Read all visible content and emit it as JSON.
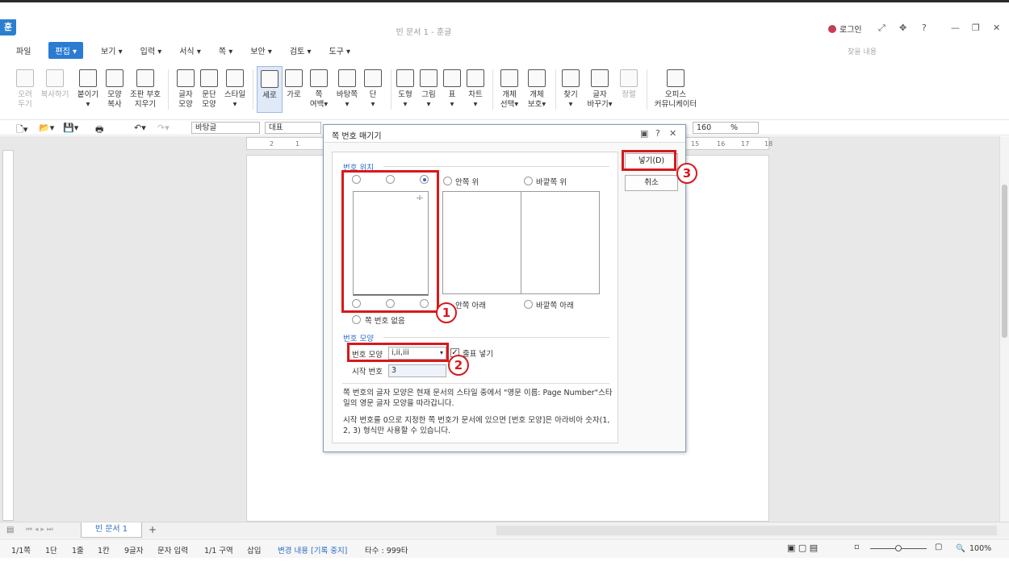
{
  "app": {
    "logo": "훈",
    "title": "빈 문서 1 - 훈글",
    "login": "로그인",
    "search_placeholder": "찾을 내용"
  },
  "menu": [
    "파일",
    "편집",
    "보기",
    "입력",
    "서식",
    "쪽",
    "보안",
    "검토",
    "도구"
  ],
  "ribbon": [
    {
      "l1": "오려",
      "l2": "두기"
    },
    {
      "l1": "복사하기",
      "l2": ""
    },
    {
      "l1": "붙이기",
      "l2": "▾"
    },
    {
      "l1": "모양",
      "l2": "복사"
    },
    {
      "l1": "조판 부호",
      "l2": "지우기"
    },
    {
      "l1": "글자",
      "l2": "모양"
    },
    {
      "l1": "문단",
      "l2": "모양"
    },
    {
      "l1": "스타일",
      "l2": "▾"
    },
    {
      "l1": "세로",
      "l2": ""
    },
    {
      "l1": "가로",
      "l2": ""
    },
    {
      "l1": "쪽",
      "l2": "여백▾"
    },
    {
      "l1": "바탕쪽",
      "l2": "▾"
    },
    {
      "l1": "단",
      "l2": "▾"
    },
    {
      "l1": "도형",
      "l2": "▾"
    },
    {
      "l1": "그림",
      "l2": "▾"
    },
    {
      "l1": "표",
      "l2": "▾"
    },
    {
      "l1": "차트",
      "l2": "▾"
    },
    {
      "l1": "개체",
      "l2": "선택▾"
    },
    {
      "l1": "개체",
      "l2": "보호▾"
    },
    {
      "l1": "찾기",
      "l2": "▾"
    },
    {
      "l1": "글자",
      "l2": "바꾸기▾"
    },
    {
      "l1": "정렬",
      "l2": ""
    },
    {
      "l1": "오피스",
      "l2": "커뮤니케이터"
    }
  ],
  "format_bar": {
    "style": "바탕글",
    "font": "대표",
    "zoom": "160",
    "zoom_unit": "%"
  },
  "ruler_numbers": [
    "2",
    "1",
    "15",
    "16",
    "17",
    "18"
  ],
  "dialog": {
    "title": "쪽 번호 매기기",
    "section_position": "번호 위치",
    "inner_top": "안쪽 위",
    "outer_top": "바깥쪽 위",
    "inner_bottom": "안쪽 아래",
    "outer_bottom": "바깥쪽 아래",
    "no_number": "쪽 번호 없음",
    "preview_mark": "-i-",
    "section_shape": "번호 모양",
    "shape_label": "번호 모양",
    "shape_value": "i,ii,iii",
    "dash_label": "줄표 넣기",
    "dash_checked": true,
    "start_label": "시작 번호",
    "start_value": "3",
    "note1": "쪽 번호의 글자 모양은 현재 문서의 스타일 중에서 \"영문 이름: Page Number\"스타일의 영문 글자 모양을 따라갑니다.",
    "note2": "시작 번호를 0으로 지정한 쪽 번호가 문서에 있으면 [번호 모양]은 아라비아 숫자(1, 2, 3) 형식만 사용할 수 있습니다.",
    "ok": "넣기(D)",
    "cancel": "취소"
  },
  "annotations": {
    "one": "1",
    "two": "2",
    "three": "3",
    "color": "#d7191c"
  },
  "tabs": {
    "doc": "빈 문서 1",
    "add": "+"
  },
  "status": {
    "page": "1/1쪽",
    "col": "1단",
    "line": "1줄",
    "kan": "1칸",
    "chars": "9글자",
    "mode": "문자 입력",
    "section": "1/1 구역",
    "insert": "삽입",
    "track": "변경 내용 [기록 중지]",
    "typing": "타수 : 999타",
    "zoom": "100%"
  }
}
